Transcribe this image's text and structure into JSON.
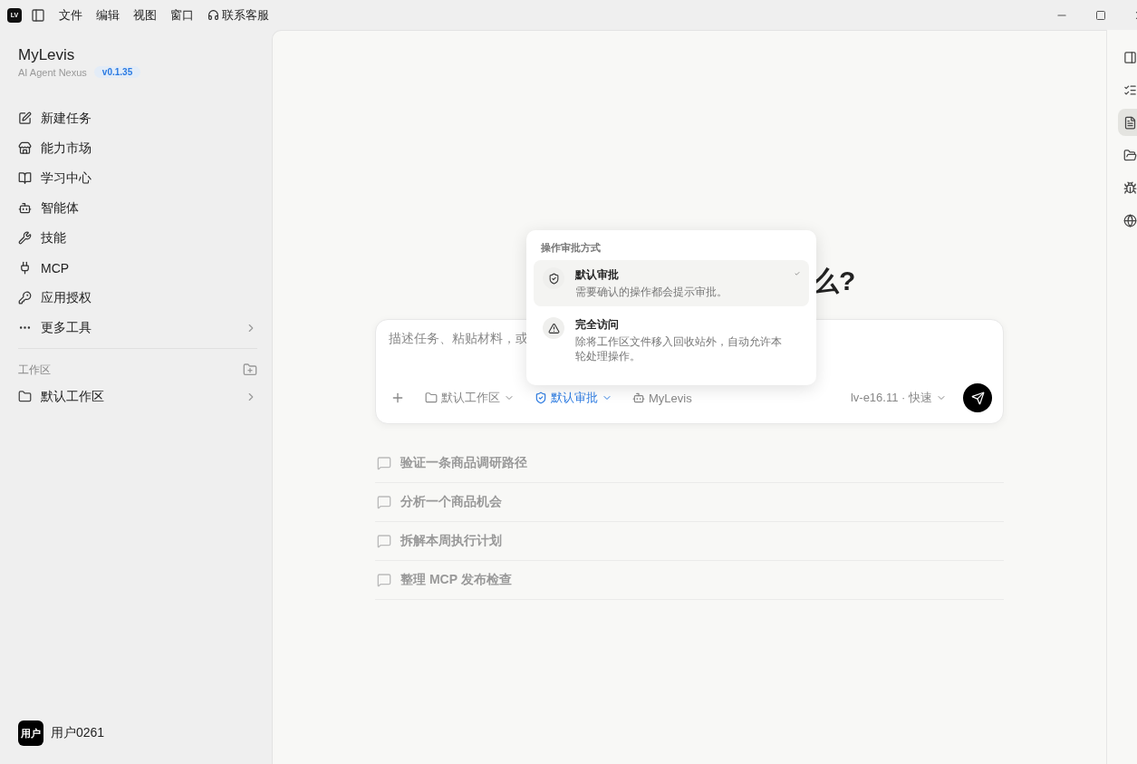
{
  "titlebar": {
    "logo": "LV",
    "menu": [
      "文件",
      "编辑",
      "视图",
      "窗口"
    ],
    "support": "联系客服"
  },
  "sidebar": {
    "title": "MyLevis",
    "subtitle": "AI Agent Nexus",
    "version": "v0.1.35",
    "nav": [
      {
        "label": "新建任务",
        "has_submenu": false
      },
      {
        "label": "能力市场",
        "has_submenu": false
      },
      {
        "label": "学习中心",
        "has_submenu": false
      },
      {
        "label": "智能体",
        "has_submenu": false
      },
      {
        "label": "技能",
        "has_submenu": false
      },
      {
        "label": "MCP",
        "has_submenu": false
      },
      {
        "label": "应用授权",
        "has_submenu": false
      },
      {
        "label": "更多工具",
        "has_submenu": true
      }
    ],
    "workspace_header": "工作区",
    "workspaces": [
      {
        "label": "默认工作区",
        "has_submenu": true
      }
    ],
    "user": {
      "avatar": "用户",
      "name": "用户0261"
    }
  },
  "main": {
    "heading": "么?",
    "composer": {
      "placeholder": "描述任务、粘贴材料，或",
      "workspace": "默认工作区",
      "approval": "默认审批",
      "agent": "MyLevis",
      "model": "lv-e16.11 · 快速"
    },
    "approval_menu": {
      "header": "操作审批方式",
      "options": [
        {
          "title": "默认审批",
          "description": "需要确认的操作都会提示审批。",
          "selected": true
        },
        {
          "title": "完全访问",
          "description": "除将工作区文件移入回收站外，自动允许本轮处理操作。",
          "selected": false
        }
      ]
    },
    "suggestions": [
      "验证一条商品调研路径",
      "分析一个商品机会",
      "拆解本周执行计划",
      "整理 MCP 发布检查"
    ]
  },
  "rail": [
    {
      "selected": false
    },
    {
      "selected": false
    },
    {
      "selected": true
    },
    {
      "selected": false
    },
    {
      "selected": false
    },
    {
      "selected": false
    }
  ]
}
